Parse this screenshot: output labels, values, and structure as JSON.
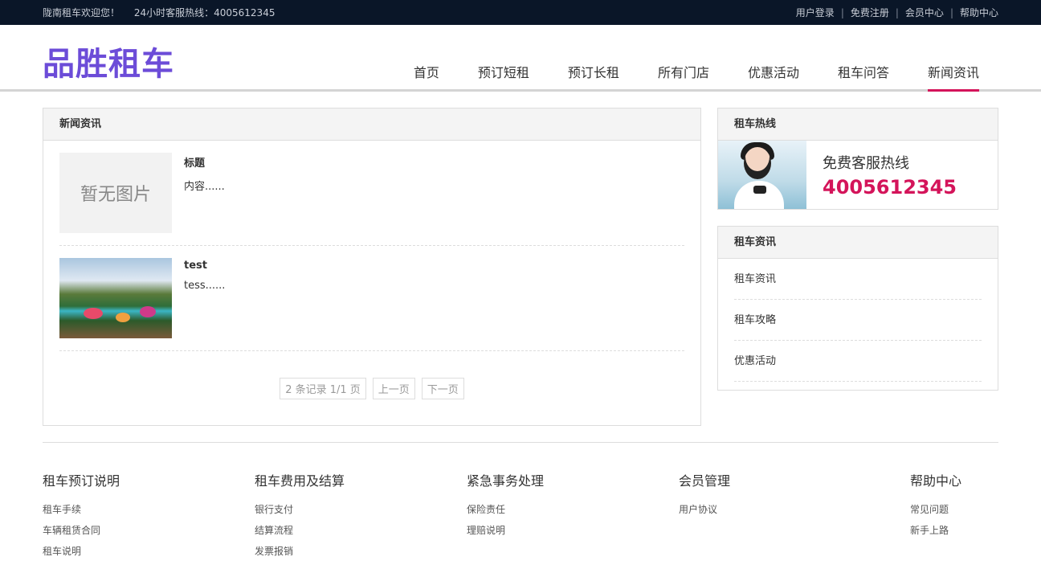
{
  "topbar": {
    "welcome": "陇南租车欢迎您！",
    "hotline_label": "24小时客服热线：4005612345",
    "links": [
      "用户登录",
      "免费注册",
      "会员中心",
      "帮助中心"
    ]
  },
  "header": {
    "logo": "品胜租车",
    "nav": [
      "首页",
      "预订短租",
      "预订长租",
      "所有门店",
      "优惠活动",
      "租车问答",
      "新闻资讯"
    ],
    "active_nav": "新闻资讯"
  },
  "news": {
    "title": "新闻资讯",
    "items": [
      {
        "title": "标题",
        "content": "内容......",
        "thumb_text": "暂无图片"
      },
      {
        "title": "test",
        "content": "tess......"
      }
    ],
    "pager": {
      "summary": "2 条记录 1/1 页",
      "prev": "上一页",
      "next": "下一页"
    }
  },
  "hotline": {
    "title": "租车热线",
    "label": "免费客服热线",
    "number": "4005612345"
  },
  "info": {
    "title": "租车资讯",
    "items": [
      "租车资讯",
      "租车攻略",
      "优惠活动"
    ]
  },
  "footer": {
    "columns": [
      {
        "title": "租车预订说明",
        "links": [
          "租车手续",
          "车辆租赁合同",
          "租车说明"
        ]
      },
      {
        "title": "租车费用及结算",
        "links": [
          "银行支付",
          "结算流程",
          "发票报销"
        ]
      },
      {
        "title": "紧急事务处理",
        "links": [
          "保险责任",
          "理赔说明"
        ]
      },
      {
        "title": "会员管理",
        "links": [
          "用户协议"
        ]
      },
      {
        "title": "帮助中心",
        "links": [
          "常见问题",
          "新手上路"
        ]
      }
    ]
  },
  "colors": {
    "topbar_bg": "#0a1628",
    "brand": "#6c4cd8",
    "accent": "#d4145a"
  }
}
